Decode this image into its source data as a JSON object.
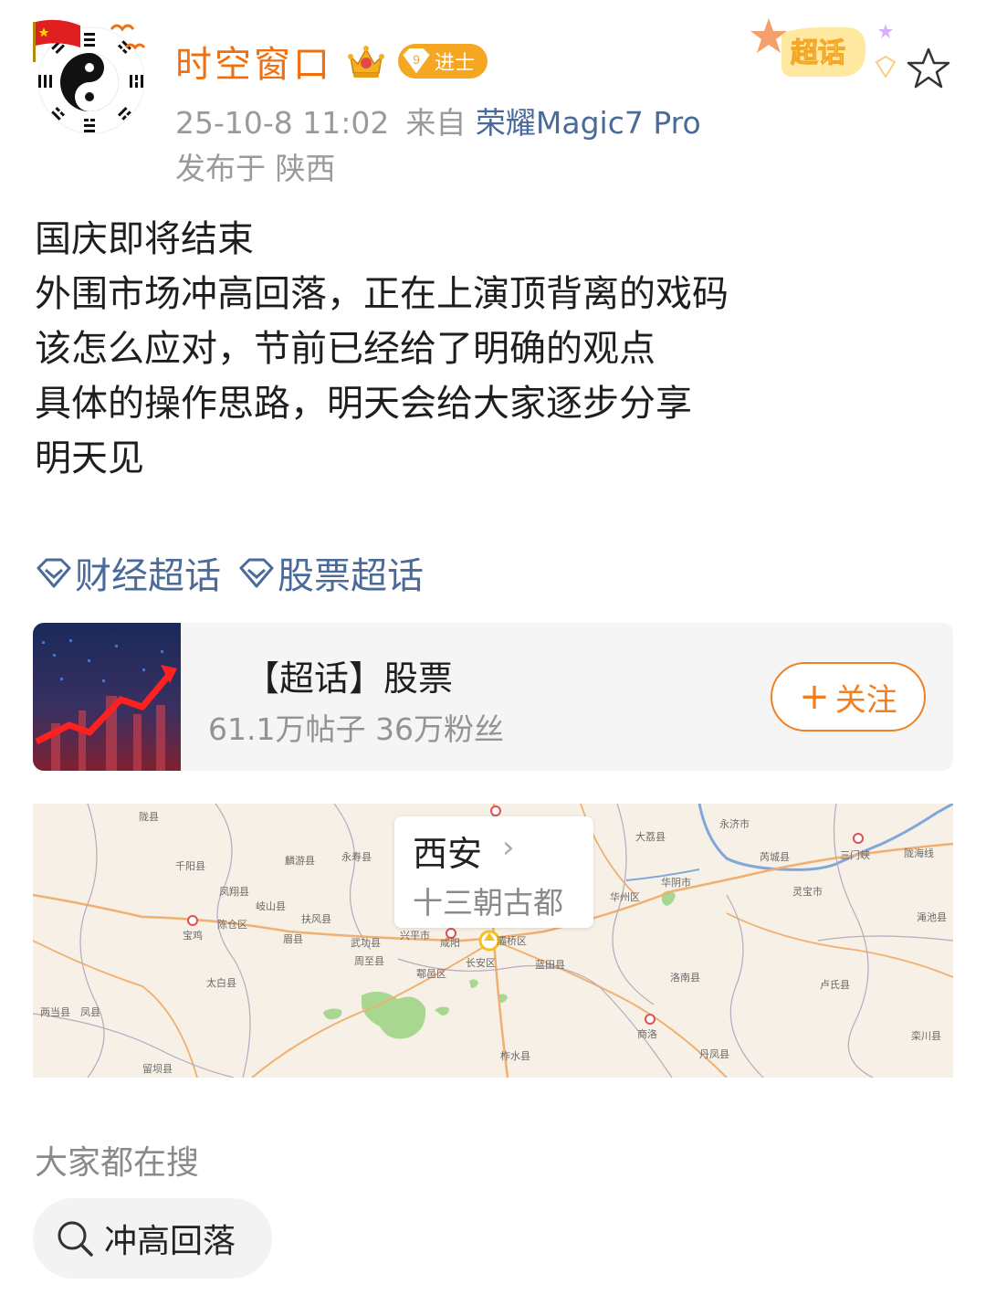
{
  "user": {
    "name": "时空窗口",
    "level_number": "9",
    "level_title": "进士",
    "timestamp": "25-10-8 11:02",
    "source_prefix": "来自",
    "device": "荣耀Magic7 Pro",
    "location": "发布于 陕西"
  },
  "badge": {
    "super_topic": "超话"
  },
  "post": {
    "lines": [
      "国庆即将结束",
      "外围市场冲高回落，正在上演顶背离的戏码",
      "该怎么应对，节前已经给了明确的观点",
      "具体的操作思路，明天会给大家逐步分享",
      "明天见"
    ]
  },
  "topics": [
    "财经超话",
    "股票超话"
  ],
  "card": {
    "title": "【超话】股票",
    "subtitle": "61.1万帖子 36万粉丝",
    "follow_label": "关注"
  },
  "map": {
    "popup_title": "西安",
    "popup_subtitle": "十三朝古都",
    "places": [
      "陇县",
      "千阳县",
      "麟游县",
      "永寿县",
      "凤翔县",
      "岐山县",
      "扶风县",
      "陈仓区",
      "宝鸡",
      "眉县",
      "武功县",
      "兴平市",
      "咸阳",
      "周至县",
      "鄠邑区",
      "长安区",
      "灞桥区",
      "蓝田县",
      "华州区",
      "华阴市",
      "大荔县",
      "永济市",
      "芮城县",
      "三门峡",
      "灵宝市",
      "陇海线",
      "渑池县",
      "洛南县",
      "卢氏县",
      "商洛",
      "丹凤县",
      "柞水县",
      "太白县",
      "两当县",
      "凤县",
      "留坝县",
      "栾川县"
    ]
  },
  "searches": {
    "heading": "大家都在搜",
    "items": [
      "冲高回落"
    ]
  }
}
